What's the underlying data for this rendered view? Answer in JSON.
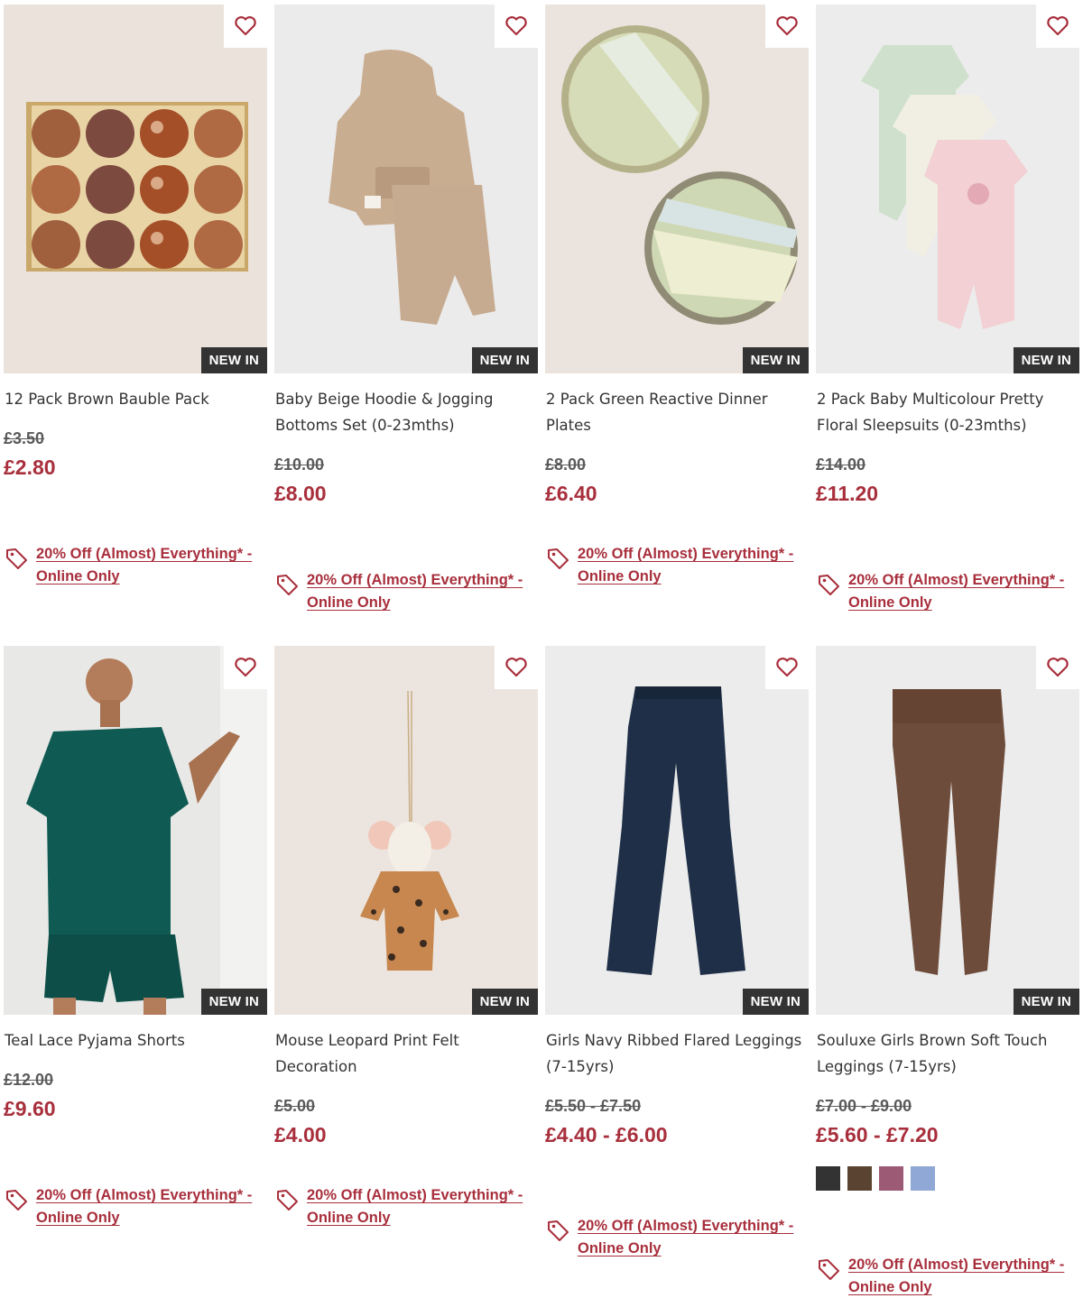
{
  "common": {
    "badge": "NEW IN",
    "promo": "20% Off (Almost) Everything* - Online Only"
  },
  "products": [
    {
      "title": "12 Pack Brown Bauble Pack",
      "was": "£3.50",
      "now": "£2.80"
    },
    {
      "title": "Baby Beige Hoodie & Jogging Bottoms Set (0-23mths)",
      "was": "£10.00",
      "now": "£8.00"
    },
    {
      "title": "2 Pack Green Reactive Dinner Plates",
      "was": "£8.00",
      "now": "£6.40"
    },
    {
      "title": "2 Pack Baby Multicolour Pretty Floral Sleepsuits (0-23mths)",
      "was": "£14.00",
      "now": "£11.20"
    },
    {
      "title": "Teal Lace Pyjama Shorts",
      "was": "£12.00",
      "now": "£9.60"
    },
    {
      "title": "Mouse Leopard Print Felt Decoration",
      "was": "£5.00",
      "now": "£4.00"
    },
    {
      "title": "Girls Navy Ribbed Flared Leggings (7-15yrs)",
      "was": "£5.50 - £7.50",
      "now": "£4.40 - £6.00"
    },
    {
      "title": "Souluxe Girls Brown Soft Touch Leggings (7-15yrs)",
      "was": "£7.00 - £9.00",
      "now": "£5.60 - £7.20",
      "swatches": [
        "#333333",
        "#5a4330",
        "#9c5a75",
        "#8fa8d6"
      ]
    }
  ],
  "colors": {
    "accent": "#a82f3c",
    "badge_bg": "#333333"
  },
  "icons": {
    "wishlist": "heart-icon",
    "promo": "price-tag-icon"
  }
}
